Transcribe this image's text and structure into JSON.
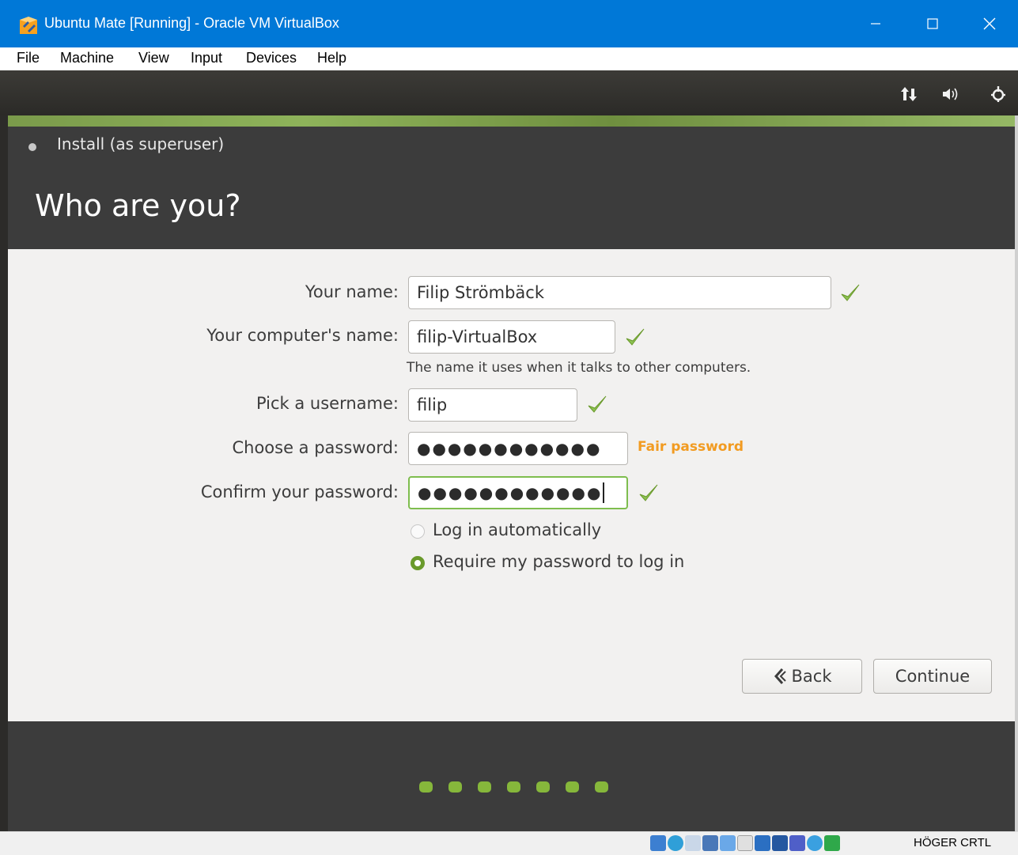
{
  "window": {
    "title": "Ubuntu Mate [Running] - Oracle VM VirtualBox"
  },
  "menu": [
    "File",
    "Machine",
    "View",
    "Input",
    "Devices",
    "Help"
  ],
  "panel_icons": [
    "network-icon",
    "volume-icon",
    "power-gear-icon"
  ],
  "installer": {
    "window_title": "Install (as superuser)",
    "heading": "Who are you?",
    "fields": {
      "name_label": "Your name:",
      "name_value": "Filip Strömbäck",
      "computer_label": "Your computer's name:",
      "computer_value": "filip-VirtualBox",
      "computer_hint": "The name it uses when it talks to other computers.",
      "username_label": "Pick a username:",
      "username_value": "filip",
      "password_label": "Choose a password:",
      "password_value": "●●●●●●●●●●●●",
      "password_strength": "Fair password",
      "confirm_label": "Confirm your password:",
      "confirm_value": "●●●●●●●●●●●●"
    },
    "login_options": {
      "auto": "Log in automatically",
      "require": "Require my password to log in",
      "selected": "require"
    },
    "buttons": {
      "back": "Back",
      "continue": "Continue"
    },
    "progress": {
      "steps": 7
    }
  },
  "statusbar": {
    "host_key": "HÖGER CRTL"
  },
  "colors": {
    "titlebar": "#0078d7",
    "accent_green": "#86b73b",
    "strength_orange": "#f29b21"
  }
}
